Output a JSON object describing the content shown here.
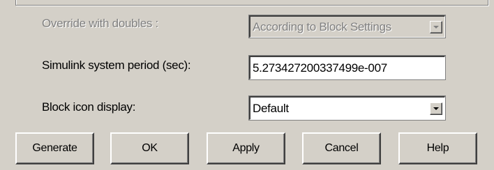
{
  "settings": {
    "override": {
      "label": "Override with doubles :",
      "value": "According to Block Settings"
    },
    "period": {
      "label": "Simulink system period (sec):",
      "value": "5.273427200337499e-007"
    },
    "icon_display": {
      "label": "Block icon display:",
      "value": "Default"
    }
  },
  "buttons": {
    "generate": "Generate",
    "ok": "OK",
    "apply": "Apply",
    "cancel": "Cancel",
    "help": "Help"
  },
  "colors": {
    "face": "#d4d0c8",
    "disabled_text": "#808080"
  },
  "icons": {
    "dropdown": "chevron-down-icon"
  }
}
